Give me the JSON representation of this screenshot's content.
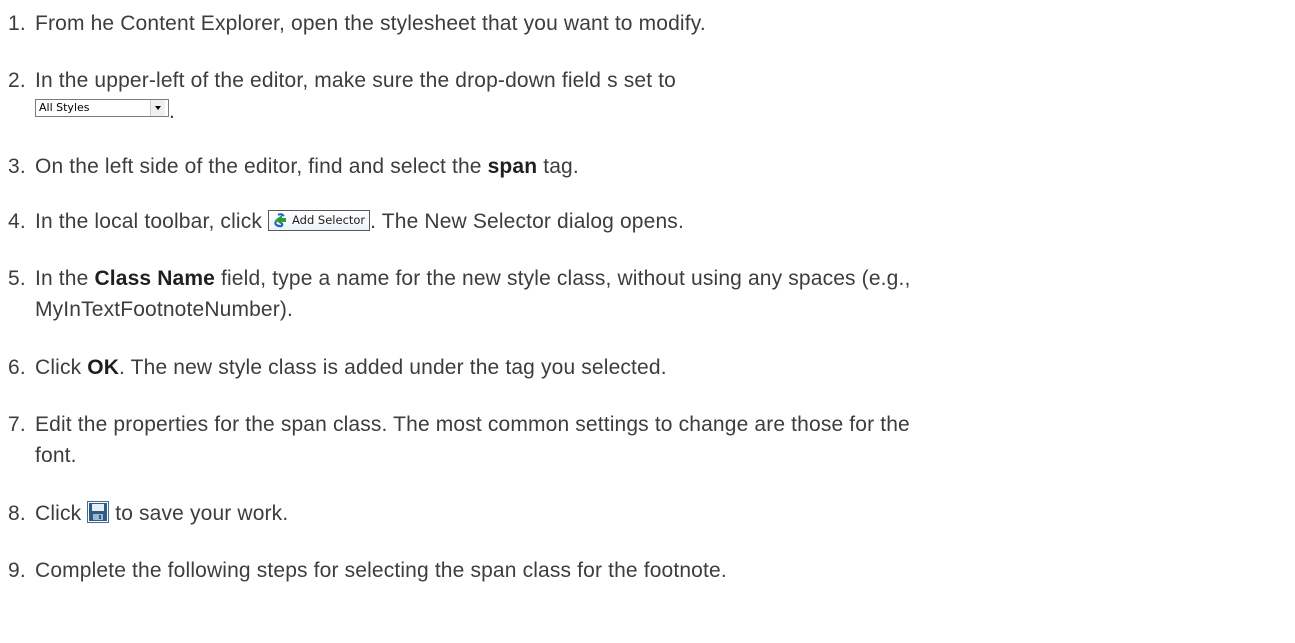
{
  "steps": [
    {
      "number": "1.",
      "text": "From  he Content Explorer, open the stylesheet that you want to modify."
    },
    {
      "number": "2.",
      "text_before": "In the upper-left of the editor, make sure the drop-down field  s set to",
      "dropdown_value": "All Styles",
      "text_after": "."
    },
    {
      "number": "3.",
      "text_before": "On the left side of the editor, find and select the ",
      "bold": "span",
      "text_after": " tag."
    },
    {
      "number": "4.",
      "text_before": "In the local toolbar, click ",
      "button_label": "Add Selector",
      "text_after": ". The New Selector dialog opens."
    },
    {
      "number": "5.",
      "text_before": "In the ",
      "bold": "Class Name",
      "text_line1_after": " field, type a name for the new style class, without using any spaces (e.g.,",
      "text_line2": "MyInTextFootnoteNumber)."
    },
    {
      "number": "6.",
      "text_before": "Click ",
      "bold": "OK",
      "text_after": ". The new style class is added under the tag you selected."
    },
    {
      "number": "7.",
      "text_line1": "Edit the properties for the span class. The most common settings to change are those for the",
      "text_line2": "font."
    },
    {
      "number": "8.",
      "text_before": "Click ",
      "text_after": " to save your work.",
      "icon": "save-disk-icon"
    },
    {
      "number": "9.",
      "text": "Complete the following steps for selecting the span class for the footnote."
    }
  ]
}
